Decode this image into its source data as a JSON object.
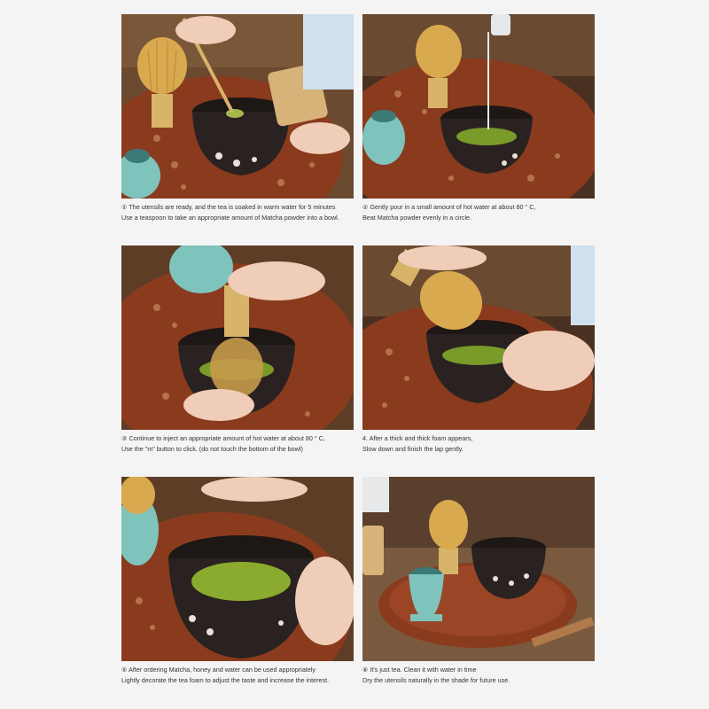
{
  "steps": [
    {
      "line1": "① The utensils are ready, and the tea is soaked in warm water for 5 minutes",
      "line2": "Use a teaspoon to take an appropriate amount of Matcha powder into a bowl."
    },
    {
      "line1": "② Gently pour in a small amount of hot water at about 80 ° C,",
      "line2": "Beat Matcha powder evenly in a circle."
    },
    {
      "line1": "③ Continue to inject an appropriate amount of hot water at about 80 ° C,",
      "line2": "Use the \"m\" button to click. (do not touch the bottom of the bowl)"
    },
    {
      "line1": "4. After a thick and thick foam appears,",
      "line2": "Slow down and finish the lap gently."
    },
    {
      "line1": "⑤ After ordering Matcha, honey and water can be used appropriately",
      "line2": "Lightly decorate the tea foam to adjust the taste and increase the interest."
    },
    {
      "line1": "⑥ It's just tea. Clean it with water in time",
      "line2": "Dry the utensils naturally in the shade for future use."
    }
  ],
  "colors": {
    "background": "#f4f4f4",
    "tray": "#8a3b1e",
    "table": "#6b4a30",
    "bowl": "#2a2220",
    "matcha": "#7a9a2a",
    "whisk": "#d8b46a",
    "ceramic": "#7fc3bd"
  }
}
